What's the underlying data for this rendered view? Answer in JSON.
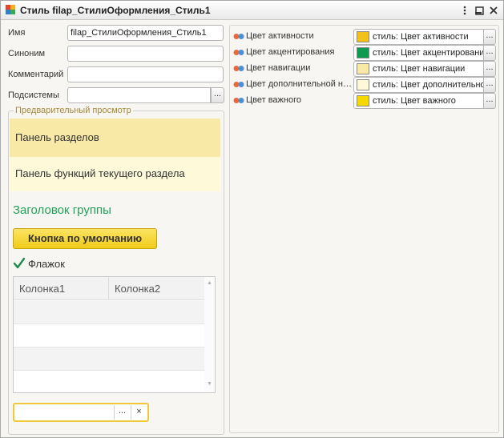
{
  "window": {
    "title": "Стиль filap_СтилиОформления_Стиль1",
    "minimize_glyph": "▁",
    "maximize_glyph": "☐",
    "close_glyph": "✕"
  },
  "fields": {
    "name_label": "Имя",
    "name_value": "filap_СтилиОформления_Стиль1",
    "synonym_label": "Синоним",
    "synonym_value": "",
    "comment_label": "Комментарий",
    "comment_value": "",
    "subsystems_label": "Подсистемы",
    "subsystems_value": "",
    "picker_glyph": "..."
  },
  "preview": {
    "title": "Предварительный просмотр",
    "sections_panel": "Панель разделов",
    "functions_panel": "Панель функций текущего раздела",
    "group_header": "Заголовок группы",
    "default_button": "Кнопка по умолчанию",
    "checkbox_label": "Флажок",
    "checkbox_checked": true,
    "table_columns": [
      "Колонка1",
      "Колонка2"
    ],
    "bottom_field_btn1": "...",
    "bottom_field_btn2": "×"
  },
  "colors": [
    {
      "name": "Цвет активности",
      "value": "стиль: Цвет активности",
      "swatch": "#f2c21b"
    },
    {
      "name": "Цвет акцентирования",
      "value": "стиль: Цвет акцентирования",
      "swatch": "#0f9b4d"
    },
    {
      "name": "Цвет навигации",
      "value": "стиль: Цвет навигации",
      "swatch": "#f8e9a7"
    },
    {
      "name": "Цвет дополнительной навигации",
      "value": "стиль: Цвет дополнительной навигации",
      "swatch": "#fdf9d9"
    },
    {
      "name": "Цвет важного",
      "value": "стиль: Цвет важного",
      "swatch": "#f5d800"
    }
  ],
  "colors_picker_glyph": "..."
}
